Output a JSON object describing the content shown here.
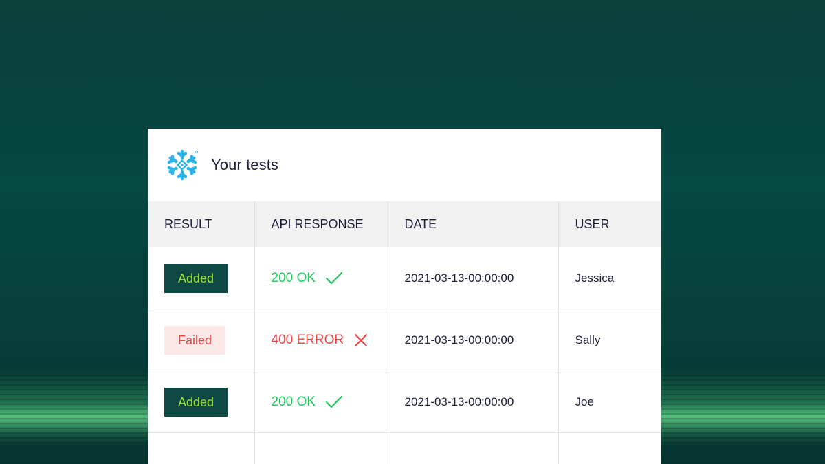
{
  "card": {
    "title": "Your tests",
    "logo_icon": "snowflake-icon",
    "logo_color": "#29b5e8"
  },
  "table": {
    "headers": [
      "RESULT",
      "API RESPONSE",
      "DATE",
      "USER"
    ],
    "rows": [
      {
        "result": "Added",
        "result_status": "success",
        "response": "200 OK",
        "response_icon": "check-icon",
        "date": "2021-03-13-00:00:00",
        "user": "Jessica"
      },
      {
        "result": "Failed",
        "result_status": "failure",
        "response": "400 ERROR",
        "response_icon": "x-icon",
        "date": "2021-03-13-00:00:00",
        "user": "Sally"
      },
      {
        "result": "Added",
        "result_status": "success",
        "response": "200 OK",
        "response_icon": "check-icon",
        "date": "2021-03-13-00:00:00",
        "user": "Joe"
      }
    ]
  },
  "colors": {
    "background": "#064842",
    "added_badge_bg": "#0d4842",
    "added_badge_text": "#a3e635",
    "failed_badge_bg": "#fde8e8",
    "failed_badge_text": "#ef4444",
    "ok_text": "#22c55e",
    "error_text": "#ef4444"
  }
}
